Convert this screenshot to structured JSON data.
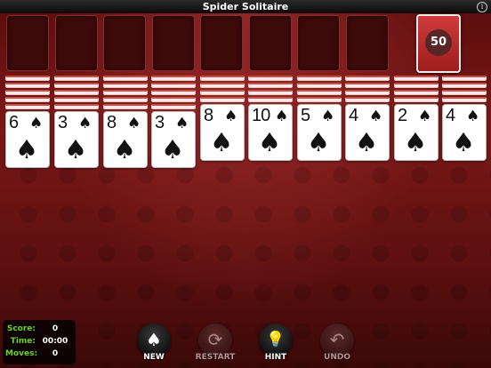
{
  "title": "Spider Solitaire",
  "info_icon": "info-icon",
  "stock": {
    "count": "50",
    "color": "#c0302f"
  },
  "suit_glyph": "♠",
  "columns": [
    {
      "rank": "6",
      "backs": 5
    },
    {
      "rank": "3",
      "backs": 5
    },
    {
      "rank": "8",
      "backs": 5
    },
    {
      "rank": "3",
      "backs": 5
    },
    {
      "rank": "8",
      "backs": 4
    },
    {
      "rank": "10",
      "backs": 4
    },
    {
      "rank": "5",
      "backs": 4
    },
    {
      "rank": "4",
      "backs": 4
    },
    {
      "rank": "2",
      "backs": 4
    },
    {
      "rank": "4",
      "backs": 4
    }
  ],
  "stats": {
    "score_label": "Score:",
    "score": "0",
    "time_label": "Time:",
    "time": "00:00",
    "moves_label": "Moves:",
    "moves": "0"
  },
  "buttons": {
    "new_label": "NEW",
    "new_icon": "♠",
    "restart_label": "RESTART",
    "restart_icon": "⟳",
    "hint_label": "HINT",
    "hint_icon": "💡",
    "undo_label": "UNDO",
    "undo_icon": "↶"
  },
  "colors": {
    "stats_label": "#6bd21e",
    "card_back_stripe": "#cc4b3c"
  }
}
